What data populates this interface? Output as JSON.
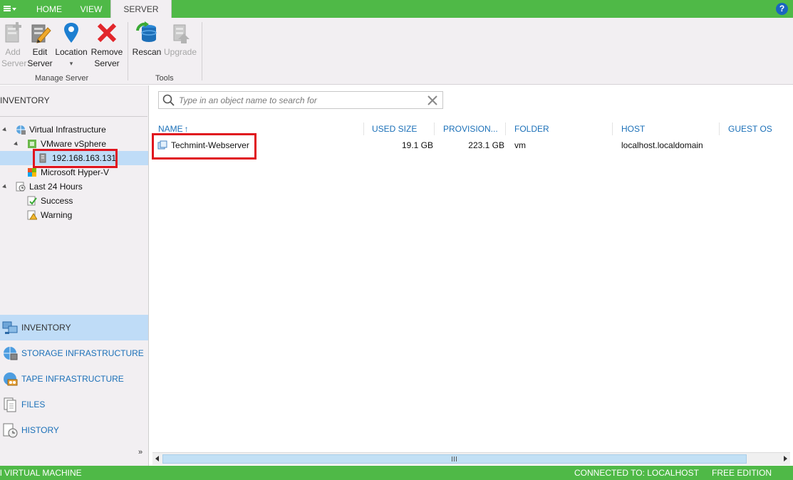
{
  "ribbon": {
    "tabs": [
      {
        "label": "HOME"
      },
      {
        "label": "VIEW"
      },
      {
        "label": "SERVER"
      }
    ],
    "help_label": "?",
    "buttons": [
      {
        "line1": "Add",
        "line2": "Server",
        "icon": "add-server-icon"
      },
      {
        "line1": "Edit",
        "line2": "Server",
        "icon": "edit-server-icon"
      },
      {
        "line1": "Location",
        "line2": "▾",
        "icon": "location-pin-icon"
      },
      {
        "line1": "Remove",
        "line2": "Server",
        "icon": "remove-server-icon"
      },
      {
        "line1": "Rescan",
        "line2": "",
        "icon": "rescan-icon"
      },
      {
        "line1": "Upgrade",
        "line2": "",
        "icon": "upgrade-icon"
      }
    ],
    "groups": [
      {
        "label": "Manage Server"
      },
      {
        "label": "Tools"
      }
    ]
  },
  "inventory": {
    "title": "INVENTORY",
    "tree": [
      {
        "label": "Virtual Infrastructure",
        "icon": "virtual-infrastructure-icon"
      },
      {
        "label": "VMware vSphere",
        "icon": "vmware-vsphere-icon"
      },
      {
        "label": "192.168.163.131",
        "icon": "esxi-host-icon",
        "selected": true
      },
      {
        "label": "Microsoft Hyper-V",
        "icon": "hyper-v-icon"
      },
      {
        "label": "Last 24 Hours",
        "icon": "history-clock-icon"
      },
      {
        "label": "Success",
        "icon": "success-icon"
      },
      {
        "label": "Warning",
        "icon": "warning-icon"
      }
    ]
  },
  "nav": [
    {
      "label": "INVENTORY",
      "icon": "inventory-icon",
      "active": true
    },
    {
      "label": "STORAGE INFRASTRUCTURE",
      "icon": "storage-infrastructure-icon"
    },
    {
      "label": "TAPE INFRASTRUCTURE",
      "icon": "tape-infrastructure-icon"
    },
    {
      "label": "FILES",
      "icon": "files-icon"
    },
    {
      "label": "HISTORY",
      "icon": "history-icon"
    }
  ],
  "nav_more": "»",
  "search": {
    "placeholder": "Type in an object name to search for"
  },
  "table": {
    "columns": [
      "NAME",
      "USED SIZE",
      "PROVISION...",
      "FOLDER",
      "HOST",
      "GUEST OS"
    ],
    "sort_indicator": "↑",
    "rows": [
      {
        "name": "Techmint-Webserver",
        "used_size": "19.1 GB",
        "provisioned": "223.1 GB",
        "folder": "vm",
        "host": "localhost.localdomain",
        "guest_os": ""
      }
    ]
  },
  "status": {
    "left": "l VIRTUAL MACHINE",
    "connected": "CONNECTED TO: LOCALHOST",
    "edition": "FREE EDITION"
  },
  "colors": {
    "accent_green": "#4fb947",
    "selection_blue": "#bfdcf7",
    "link_blue": "#1b70b8",
    "highlight_red": "#e0141e"
  }
}
